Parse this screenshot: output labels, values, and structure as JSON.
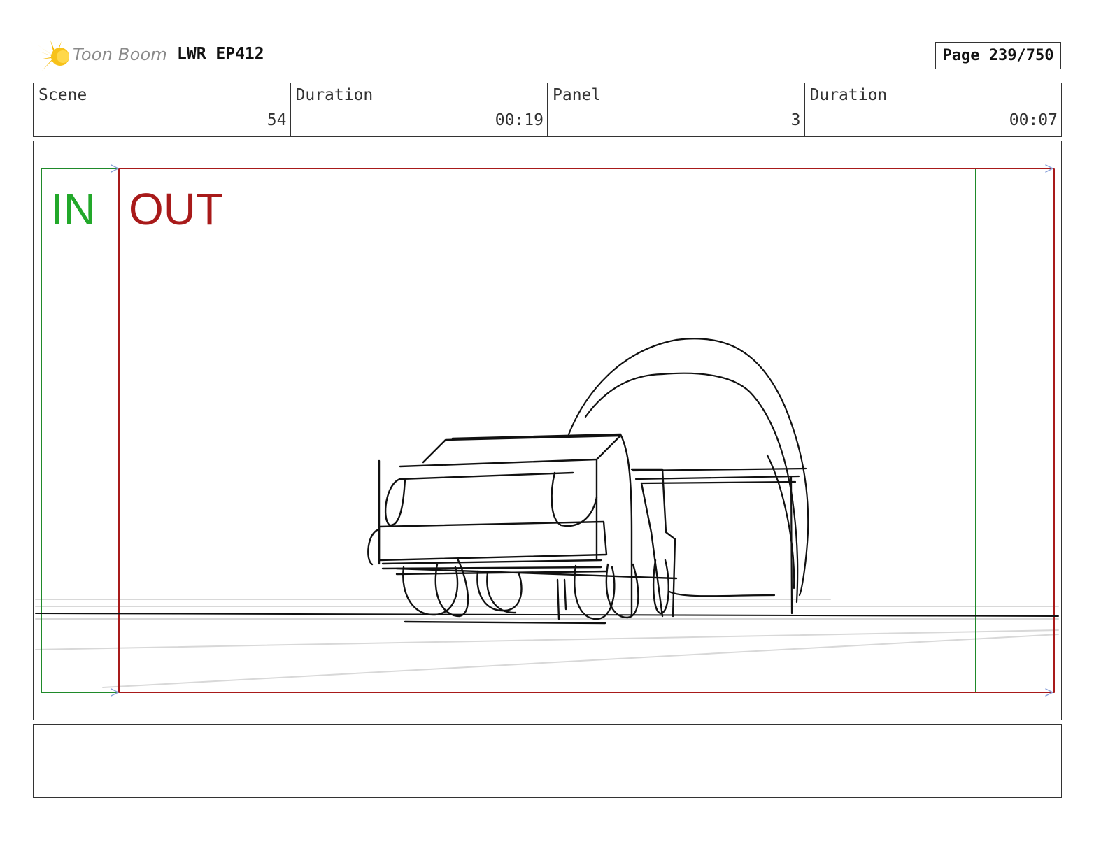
{
  "header": {
    "logo_text": "Toon Boom",
    "project_title": "LWR EP412",
    "page_label": "Page 239/750"
  },
  "info": [
    {
      "label": "Scene",
      "value": "54"
    },
    {
      "label": "Duration",
      "value": "00:19"
    },
    {
      "label": "Panel",
      "value": "3"
    },
    {
      "label": "Duration",
      "value": "00:07"
    }
  ],
  "panel": {
    "in_label": "IN",
    "out_label": "OUT",
    "in_color": "#22a82a",
    "out_color": "#a81a1a"
  },
  "notes": ""
}
